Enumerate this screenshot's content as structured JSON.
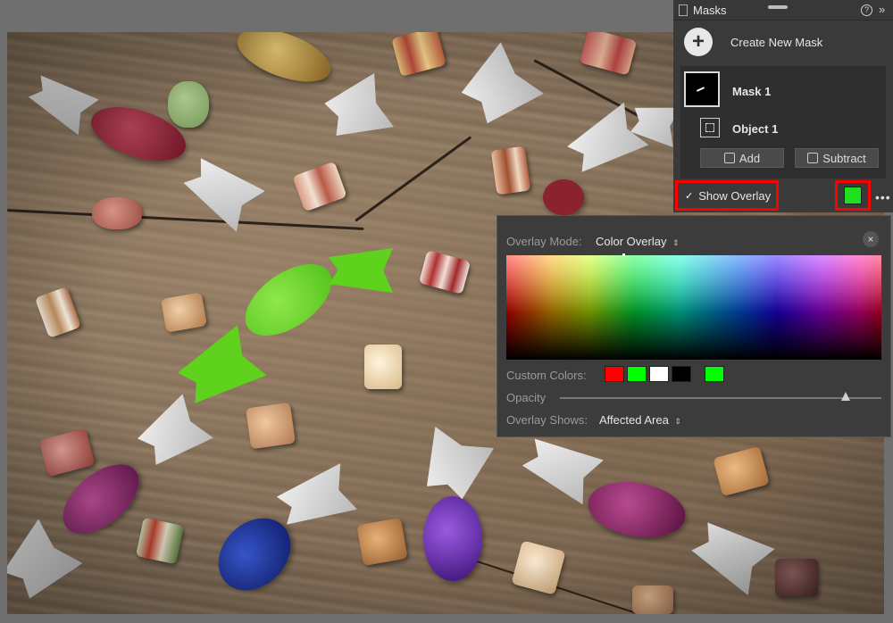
{
  "panel": {
    "title": "Masks",
    "help": "?",
    "collapse": "»",
    "create_label": "Create New Mask",
    "plus": "+",
    "mask_name": "Mask 1",
    "object_name": "Object 1",
    "add_label": "Add",
    "subtract_label": "Subtract",
    "show_overlay_label": "Show Overlay",
    "show_overlay_checked": true,
    "check_glyph": "✓",
    "overlay_color": "#1ee01e",
    "more": "•••"
  },
  "popup": {
    "overlay_mode_label": "Overlay Mode:",
    "overlay_mode_value": "Color Overlay",
    "custom_colors_label": "Custom Colors:",
    "custom_colors": [
      "#ff0000",
      "#00ff00",
      "#ffffff",
      "#000000"
    ],
    "selected_color": "#00ff00",
    "opacity_label": "Opacity",
    "opacity_value": 0.89,
    "overlay_shows_label": "Overlay Shows:",
    "overlay_shows_value": "Affected Area",
    "close": "×",
    "dropdown_glyph": "⇕"
  },
  "icons": {
    "panel": "panel-icon",
    "help": "help-icon",
    "collapse": "collapse-icon",
    "plus": "plus-icon",
    "add": "add-brush-icon",
    "subtract": "subtract-brush-icon",
    "close": "close-icon",
    "more": "more-icon"
  },
  "colors": {
    "highlight": "#ff0000",
    "mask_overlay": "#5fd21e"
  }
}
